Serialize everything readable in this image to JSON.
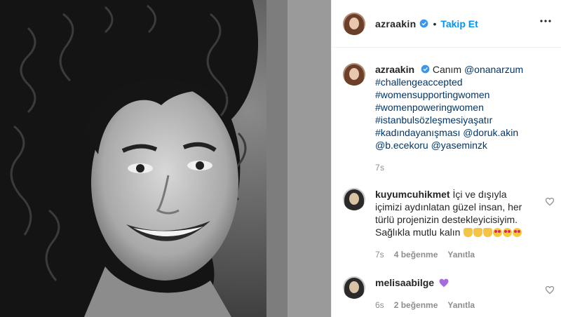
{
  "post": {
    "username": "azraakin",
    "separator": "•",
    "follow_label": "Takip Et",
    "caption_prefix": "Canım",
    "caption_lines": [
      "@onanarzum",
      "#challengeaccepted",
      "#womensupportingwomen",
      "#womenpoweringwomen",
      "#istanbulsözleşmesiyaşatır",
      "#kadındayanışması",
      "@doruk.akin",
      "@b.ecekoru",
      "@yaseminzk"
    ],
    "time": "7s"
  },
  "comments": [
    {
      "username": "kuyumcuhikmet",
      "text_lines": [
        "İçi ve dışıyla",
        "içimizi aydınlatan güzel insan, her",
        "türlü projenizin destekleyicisiyim.",
        "Sağlıkla mutlu kalın"
      ],
      "emojis": [
        "pray",
        "pray",
        "pray",
        "heart-eyes",
        "heart-eyes",
        "heart-eyes"
      ],
      "time": "7s",
      "likes": "4 beğenme",
      "reply_label": "Yanıtla"
    },
    {
      "username": "melisaabilge",
      "emojis": [
        "purple-heart"
      ],
      "time": "6s",
      "likes": "2 beğenme",
      "reply_label": "Yanıtla"
    }
  ],
  "icons": [
    "verified-badge-icon",
    "more-options-icon",
    "heart-icon"
  ],
  "colors": {
    "accent": "#0095f6",
    "link": "#00376b",
    "muted": "#8e8e8e",
    "verified": "#3897f0"
  }
}
